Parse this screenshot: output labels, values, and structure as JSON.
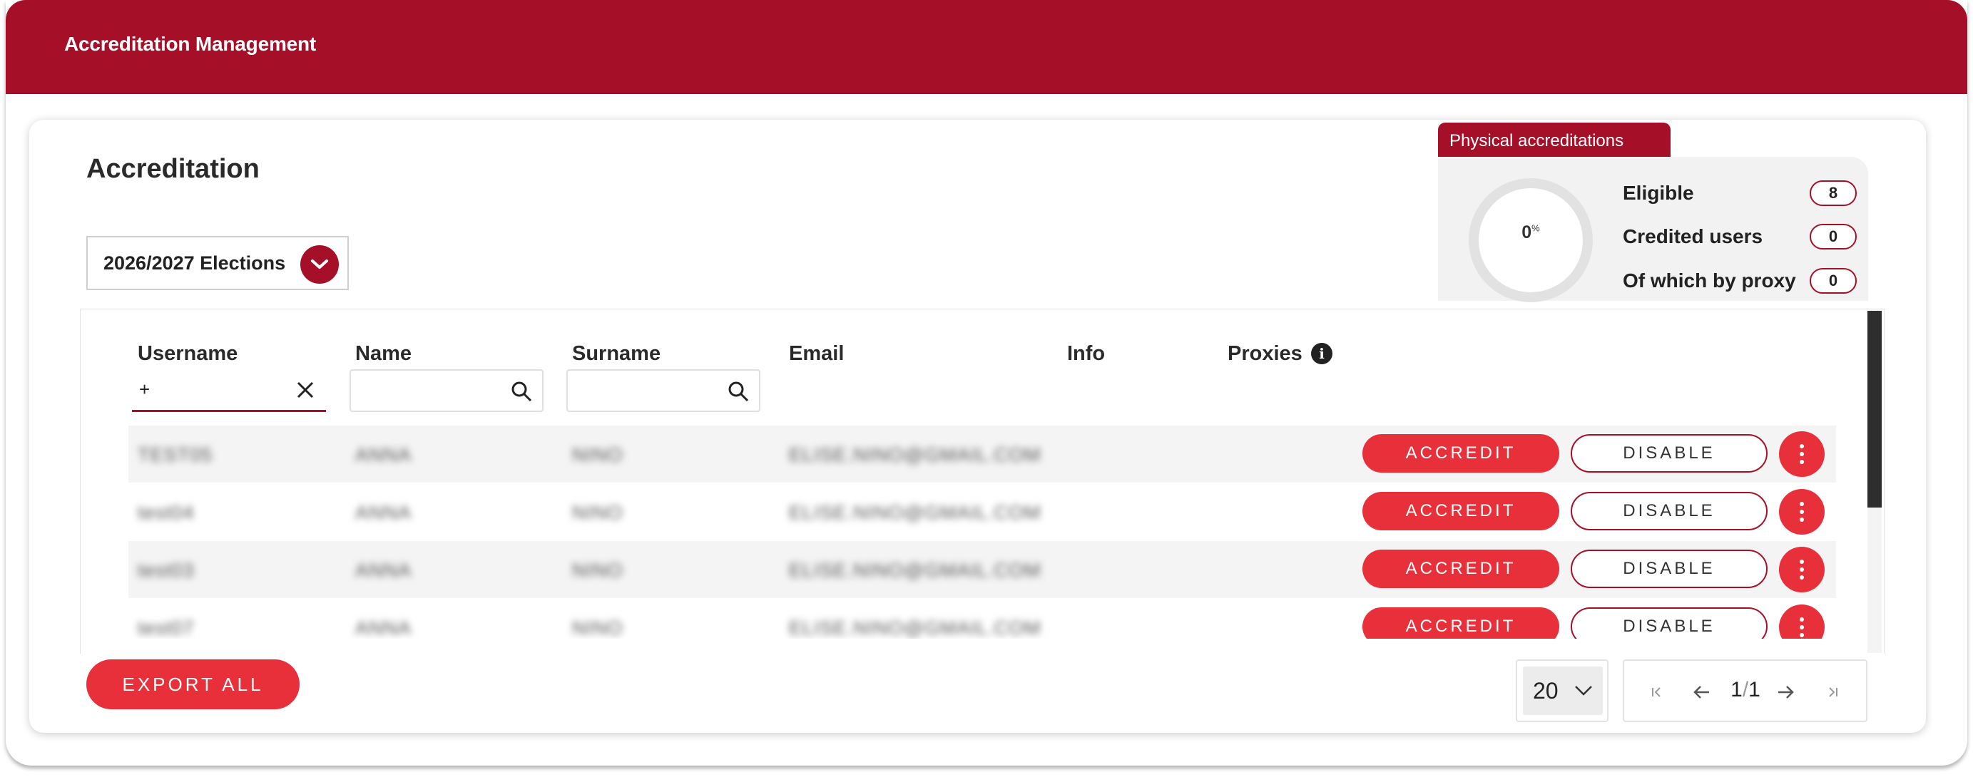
{
  "app": {
    "title": "Accreditation Management"
  },
  "page": {
    "title": "Accreditation"
  },
  "election_select": {
    "selected": "2026/2027 Elections"
  },
  "stats": {
    "tab_label": "Physical accreditations",
    "percent": "0",
    "percent_unit": "%",
    "items": [
      {
        "label": "Eligible",
        "value": "8"
      },
      {
        "label": "Credited users",
        "value": "0"
      },
      {
        "label": "Of which by proxy",
        "value": "0"
      }
    ]
  },
  "table": {
    "columns": {
      "username": "Username",
      "name": "Name",
      "surname": "Surname",
      "email": "Email",
      "info": "Info",
      "proxies": "Proxies"
    },
    "filters": {
      "username_value": "+",
      "name_value": "",
      "surname_value": ""
    },
    "rows": [
      {
        "username": "TEST05",
        "name": "ANNA",
        "surname": "NINO",
        "email": "ELISE.NINO@GMAIL.COM"
      },
      {
        "username": "test04",
        "name": "ANNA",
        "surname": "NINO",
        "email": "ELISE.NINO@GMAIL.COM"
      },
      {
        "username": "test03",
        "name": "ANNA",
        "surname": "NINO",
        "email": "ELISE.NINO@GMAIL.COM"
      },
      {
        "username": "test07",
        "name": "ANNA",
        "surname": "NINO",
        "email": "ELISE.NINO@GMAIL.COM"
      }
    ],
    "accredit_label": "ACCREDIT",
    "disable_label": "DISABLE"
  },
  "footer": {
    "export_label": "EXPORT ALL",
    "page_size": "20",
    "current_page": "1",
    "total_pages": "1"
  },
  "colors": {
    "brand": "#a51028",
    "accent": "#e8303a"
  },
  "icons": [
    "chevron-down-icon",
    "clear-icon",
    "search-icon",
    "info-icon",
    "more-vertical-icon",
    "first-page-icon",
    "prev-page-icon",
    "next-page-icon",
    "last-page-icon"
  ]
}
